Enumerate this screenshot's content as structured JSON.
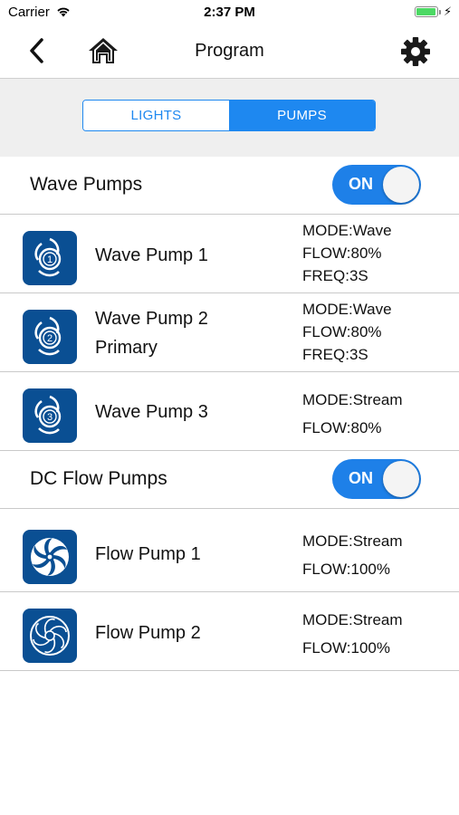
{
  "status_bar": {
    "carrier": "Carrier",
    "time": "2:37 PM"
  },
  "nav": {
    "title": "Program"
  },
  "tabs": [
    {
      "label": "LIGHTS",
      "selected": false
    },
    {
      "label": "PUMPS",
      "selected": true
    }
  ],
  "wave_section": {
    "title": "Wave Pumps",
    "toggle": "ON",
    "pumps": [
      {
        "name": "Wave Pump 1",
        "subtitle": "",
        "badge": "1",
        "info": [
          "MODE:Wave",
          "FLOW:80%",
          "FREQ:3S"
        ]
      },
      {
        "name": "Wave Pump 2",
        "subtitle": "Primary",
        "badge": "2",
        "info": [
          "MODE:Wave",
          "FLOW:80%",
          "FREQ:3S"
        ]
      },
      {
        "name": "Wave Pump 3",
        "subtitle": "",
        "badge": "3",
        "info": [
          "MODE:Stream",
          "FLOW:80%"
        ]
      }
    ]
  },
  "flow_section": {
    "title": "DC Flow Pumps",
    "toggle": "ON",
    "pumps": [
      {
        "name": "Flow Pump 1",
        "info": [
          "MODE:Stream",
          "FLOW:100%"
        ]
      },
      {
        "name": "Flow Pump 2",
        "info": [
          "MODE:Stream",
          "FLOW:100%"
        ]
      }
    ]
  },
  "colors": {
    "accent": "#1e88f0",
    "icon_bg": "#0a4f93",
    "battery": "#4cd964"
  }
}
